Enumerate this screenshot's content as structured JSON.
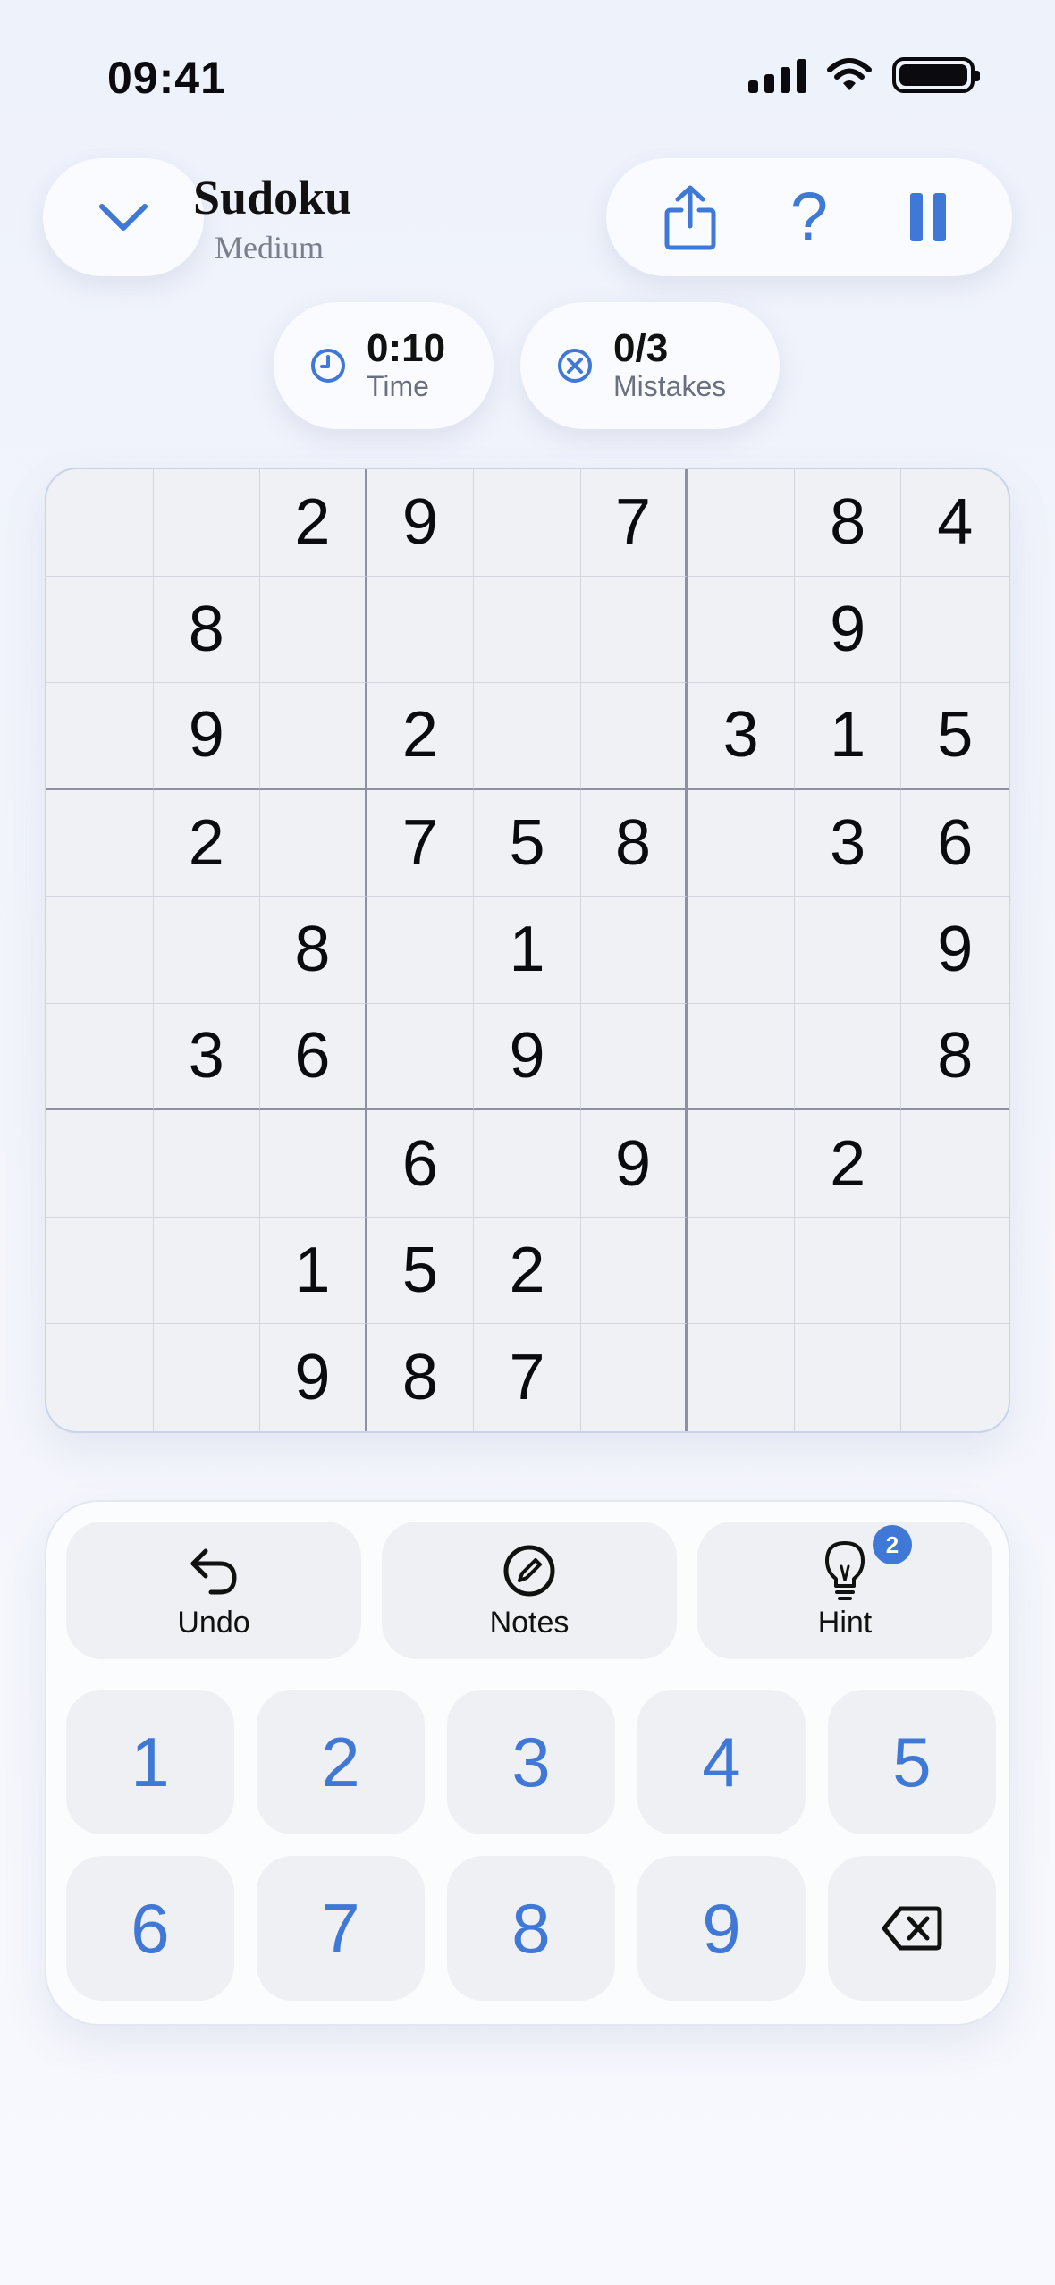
{
  "status_bar": {
    "time": "09:41"
  },
  "header": {
    "title": "Sudoku",
    "subtitle": "Medium"
  },
  "stats": {
    "time": {
      "value": "0:10",
      "label": "Time"
    },
    "mistakes": {
      "value": "0/3",
      "label": "Mistakes"
    }
  },
  "icons": {
    "collapse": "chevron-down-icon",
    "share": "share-icon",
    "help": "question-icon",
    "pause": "pause-icon",
    "clock": "clock-icon",
    "mistakes": "x-circle-icon",
    "undo": "undo-icon",
    "notes": "pencil-circle-icon",
    "hint": "lightbulb-icon",
    "erase": "backspace-icon"
  },
  "help_glyph": "?",
  "board": [
    [
      "",
      "",
      "2",
      "9",
      "",
      "7",
      "",
      "8",
      "4"
    ],
    [
      "",
      "8",
      "",
      "",
      "",
      "",
      "",
      "9",
      ""
    ],
    [
      "",
      "9",
      "",
      "2",
      "",
      "",
      "3",
      "1",
      "5"
    ],
    [
      "",
      "2",
      "",
      "7",
      "5",
      "8",
      "",
      "3",
      "6"
    ],
    [
      "",
      "",
      "8",
      "",
      "1",
      "",
      "",
      "",
      "9"
    ],
    [
      "",
      "3",
      "6",
      "",
      "9",
      "",
      "",
      "",
      "8"
    ],
    [
      "",
      "",
      "",
      "6",
      "",
      "9",
      "",
      "2",
      ""
    ],
    [
      "",
      "",
      "1",
      "5",
      "2",
      "",
      "",
      "",
      ""
    ],
    [
      "",
      "",
      "9",
      "8",
      "7",
      "",
      "",
      "",
      ""
    ]
  ],
  "tools": {
    "undo_label": "Undo",
    "notes_label": "Notes",
    "hint_label": "Hint",
    "hint_count": "2"
  },
  "keypad": [
    "1",
    "2",
    "3",
    "4",
    "5",
    "6",
    "7",
    "8",
    "9"
  ],
  "colors": {
    "accent": "#3f78d6",
    "background": "#eef2fb",
    "board": "#f0f1f5",
    "key": "#eff0f4"
  }
}
